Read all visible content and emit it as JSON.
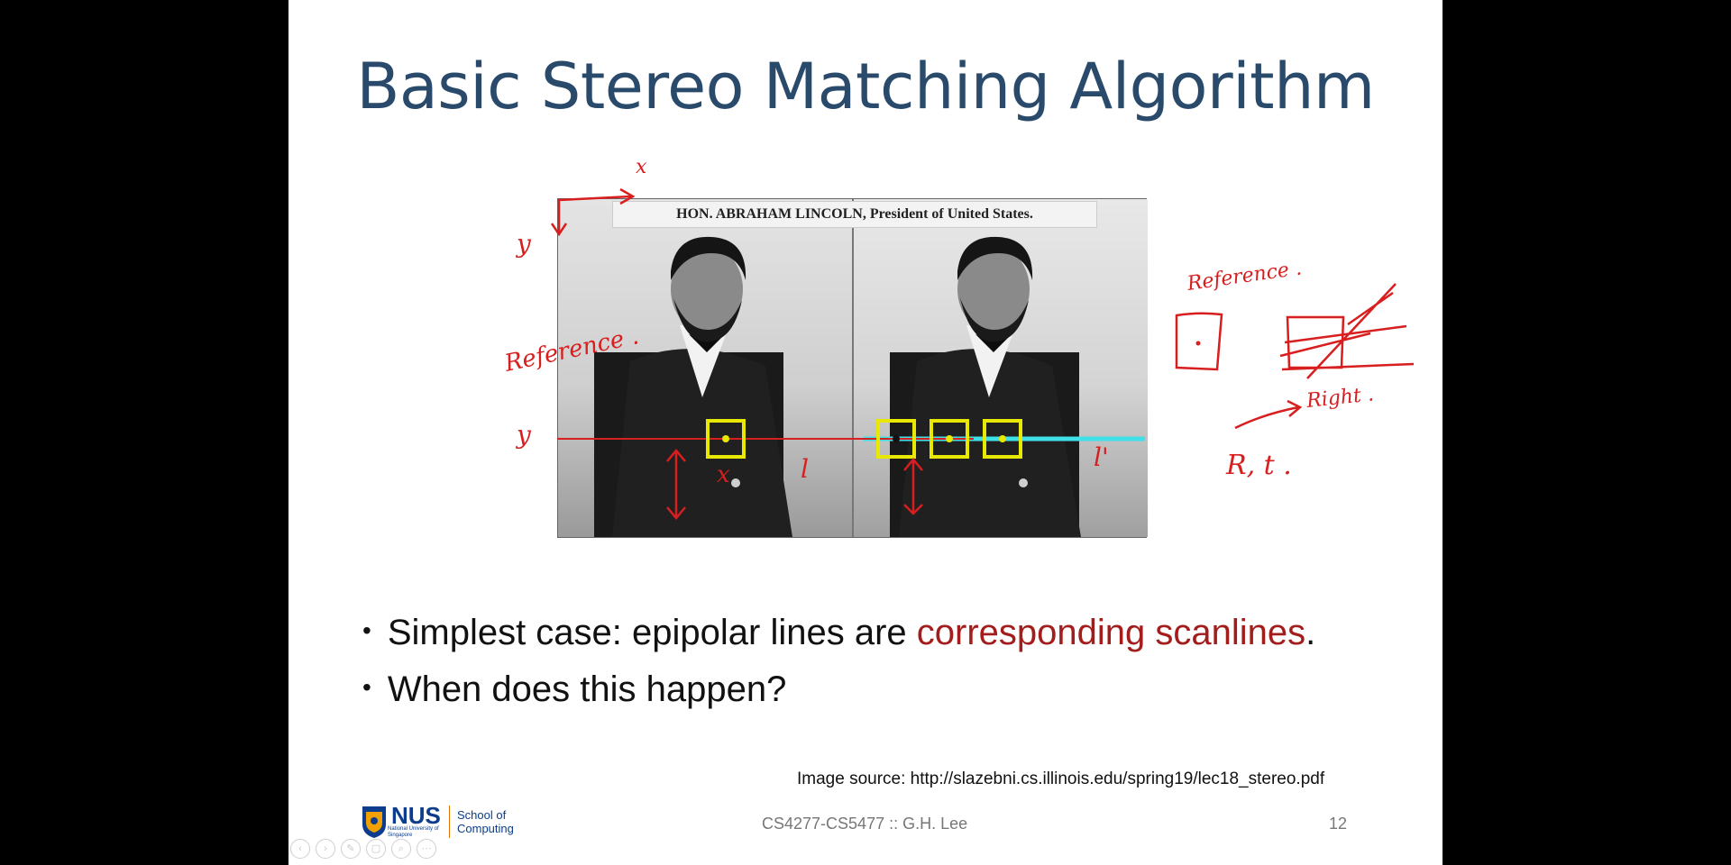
{
  "slide": {
    "title": "Basic Stereo Matching Algorithm",
    "photo_caption": "HON. ABRAHAM LINCOLN, President of United States.",
    "bullets": [
      {
        "pre": "Simplest case: epipolar lines are ",
        "accent": "corresponding scanlines",
        "post": "."
      },
      {
        "pre": "When does this happen?",
        "accent": "",
        "post": ""
      }
    ],
    "image_source": "Image source: http://slazebni.cs.illinois.edu/spring19/lec18_stereo.pdf",
    "footer": "CS4277-CS5477 :: G.H. Lee",
    "page_number": "12",
    "logo": {
      "name": "NUS",
      "subtitle": "National University of Singapore",
      "school": "School of Computing"
    }
  },
  "annotations": {
    "axis_x": "x",
    "axis_y": "y",
    "reference_left": "Reference .",
    "y_mark": "y",
    "x_mark": "x",
    "l_mark": "l",
    "l_prime_mark": "l'",
    "reference_right": "Reference .",
    "right_mark": "Right .",
    "rt_mark": "R, t ."
  },
  "colors": {
    "title": "#2a4a6b",
    "accent": "#a31d1d",
    "ink": "#d81e1e",
    "match_box": "#e8e800",
    "epipolar": "#3fe0e8"
  },
  "controls": [
    "previous-icon",
    "next-icon",
    "pen-icon",
    "slides-icon",
    "zoom-icon",
    "more-icon"
  ]
}
